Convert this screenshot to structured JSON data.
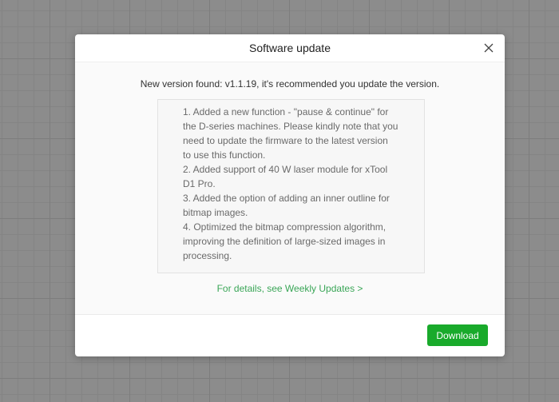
{
  "dialog": {
    "title": "Software update",
    "close_icon": "close-icon",
    "found_text": "New version found: v1.1.19, it's recommended you update the version.",
    "notes": [
      "1. Added a new function - \"pause & continue\" for",
      "the D-series machines. Please kindly note that you",
      "need to update the firmware to the latest version",
      "to use this function.",
      "2. Added support of 40 W laser module for xTool",
      "D1 Pro.",
      "3. Added the option of adding an inner outline for",
      "bitmap images.",
      "4. Optimized the bitmap compression algorithm,",
      "improving the definition of large-sized images in",
      "processing."
    ],
    "details_link": "For details, see Weekly Updates >",
    "download_label": "Download",
    "accent": "#19aa2b"
  }
}
